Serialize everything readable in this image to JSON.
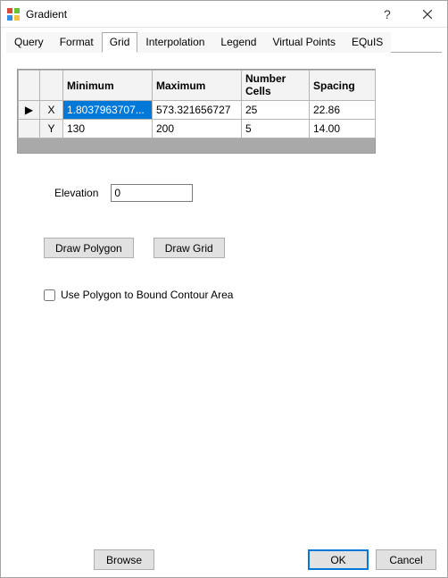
{
  "window": {
    "title": "Gradient"
  },
  "tabs": {
    "items": [
      {
        "label": "Query"
      },
      {
        "label": "Format"
      },
      {
        "label": "Grid"
      },
      {
        "label": "Interpolation"
      },
      {
        "label": "Legend"
      },
      {
        "label": "Virtual Points"
      },
      {
        "label": "EQuIS"
      }
    ],
    "activeIndex": 2
  },
  "grid": {
    "headers": {
      "min": "Minimum",
      "max": "Maximum",
      "cells": "Number Cells",
      "spacing": "Spacing"
    },
    "rows": [
      {
        "axis": "X",
        "min": "1.8037963707...",
        "max": "573.321656727",
        "cells": "25",
        "spacing": "22.86",
        "current": true
      },
      {
        "axis": "Y",
        "min": "130",
        "max": "200",
        "cells": "5",
        "spacing": "14.00",
        "current": false
      }
    ],
    "rowmarker": "▶"
  },
  "elevation": {
    "label": "Elevation",
    "value": "0"
  },
  "buttons": {
    "drawPolygon": "Draw Polygon",
    "drawGrid": "Draw Grid"
  },
  "checkbox": {
    "labelBound": "Use Polygon to Bound Contour Area",
    "checked": false
  },
  "footer": {
    "browse": "Browse",
    "ok": "OK",
    "cancel": "Cancel"
  }
}
